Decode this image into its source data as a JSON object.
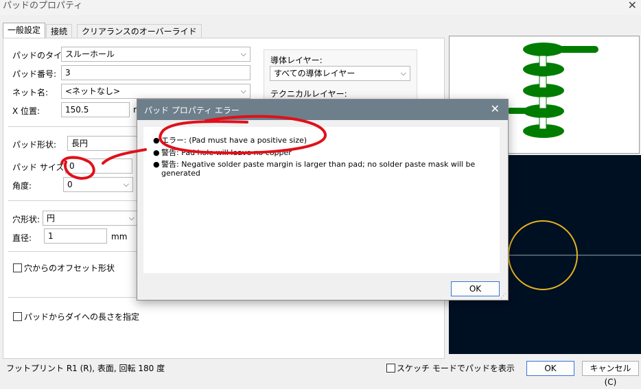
{
  "window": {
    "title": "パッドのプロパティ"
  },
  "tabs": [
    "一般設定",
    "接続",
    "クリアランスのオーバーライド"
  ],
  "general": {
    "pad_type_label": "パッドのタイプ:",
    "pad_type_value": "スルーホール",
    "pad_number_label": "パッド番号:",
    "pad_number_value": "3",
    "net_label": "ネット名:",
    "net_value": "<ネットなし>",
    "x_pos_label": "X 位置:",
    "x_pos_value": "150.5",
    "x_pos_unit_partial": "r",
    "copper_layers_label": "導体レイヤー:",
    "copper_layers_value": "すべての導体レイヤー",
    "technical_layers_label": "テクニカルレイヤー:",
    "pad_shape_label": "パッド形状:",
    "pad_shape_value": "長円",
    "pad_size_x_label": "パッド サイズ X:",
    "pad_size_x_value": "0",
    "angle_label": "角度:",
    "angle_value": "0",
    "hole_shape_label": "穴形状:",
    "hole_shape_value": "円",
    "diameter_label": "直径:",
    "diameter_value": "1",
    "diameter_unit": "mm",
    "offset_label": "穴からのオフセット形状",
    "die_length_label": "パッドからダイへの長さを指定"
  },
  "footer": {
    "footprint_info": "フットプリント R1 (R), 表面, 回転 180 度",
    "sketch_mode_label": "スケッチ モードでパッドを表示",
    "ok_label": "OK",
    "cancel_label": "キャンセル (C)"
  },
  "error_dialog": {
    "title": "パッド プロパティ エラー",
    "messages": [
      "エラー: (Pad must have a positive size)",
      "警告: Pad hole will leave no copper",
      "警告: Negative solder paste margin is larger than pad; no solder paste mask will be generated"
    ],
    "ok_label": "OK"
  },
  "colors": {
    "pad_green": "#007d00",
    "preview_dark_bg": "#001023",
    "hole_ring": "#e3b51f",
    "annotation_red": "#e0101a",
    "dialog_titlebar": "#6d7f8b"
  }
}
